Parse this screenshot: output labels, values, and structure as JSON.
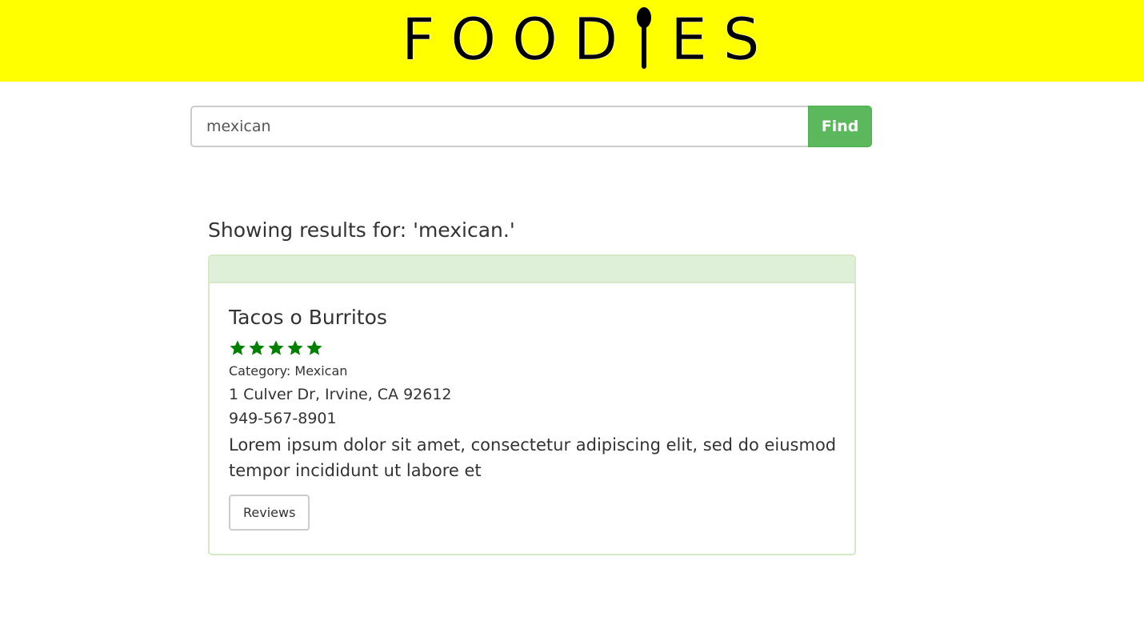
{
  "header": {
    "logo_text_before": "FOOD",
    "logo_text_after": "ES",
    "logo_icon": "spoon-icon",
    "background_color": "#ffff00"
  },
  "search": {
    "value": "mexican",
    "button_label": "Find",
    "button_color": "#5cb85c"
  },
  "results": {
    "heading": "Showing results for: 'mexican.'",
    "items": [
      {
        "name": "Tacos o Burritos",
        "rating": 5,
        "rating_max": 5,
        "star_color": "#008000",
        "category": "Category: Mexican",
        "address": "1 Culver Dr, Irvine, CA 92612",
        "phone": "949-567-8901",
        "description": "Lorem ipsum dolor sit amet, consectetur adipiscing elit, sed do eiusmod tempor incididunt ut labore et",
        "reviews_label": "Reviews"
      }
    ]
  }
}
